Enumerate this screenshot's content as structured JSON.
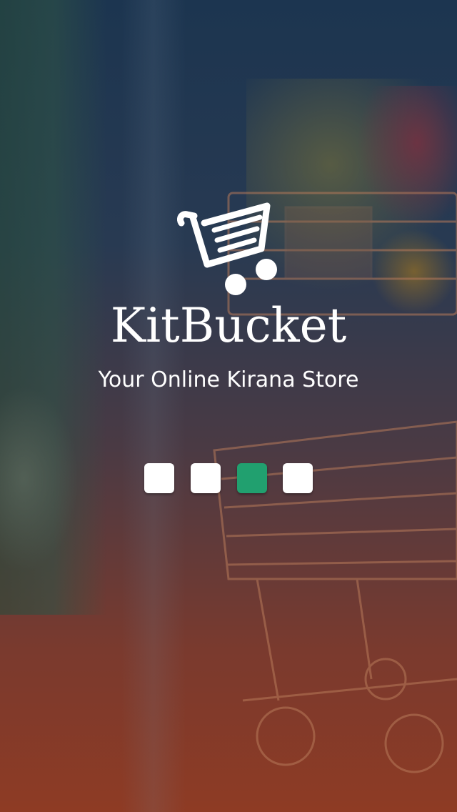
{
  "app": {
    "name": "KitBucket",
    "tagline": "Your Online Kirana Store"
  },
  "logo": {
    "icon": "shopping-cart-icon"
  },
  "loader": {
    "total_steps": 4,
    "active_step": 3,
    "dot_color": "#ffffff",
    "active_color": "#21a06f"
  },
  "colors": {
    "overlay_top": "#1c3550",
    "overlay_bottom": "#8e3b24",
    "text": "#ffffff"
  }
}
